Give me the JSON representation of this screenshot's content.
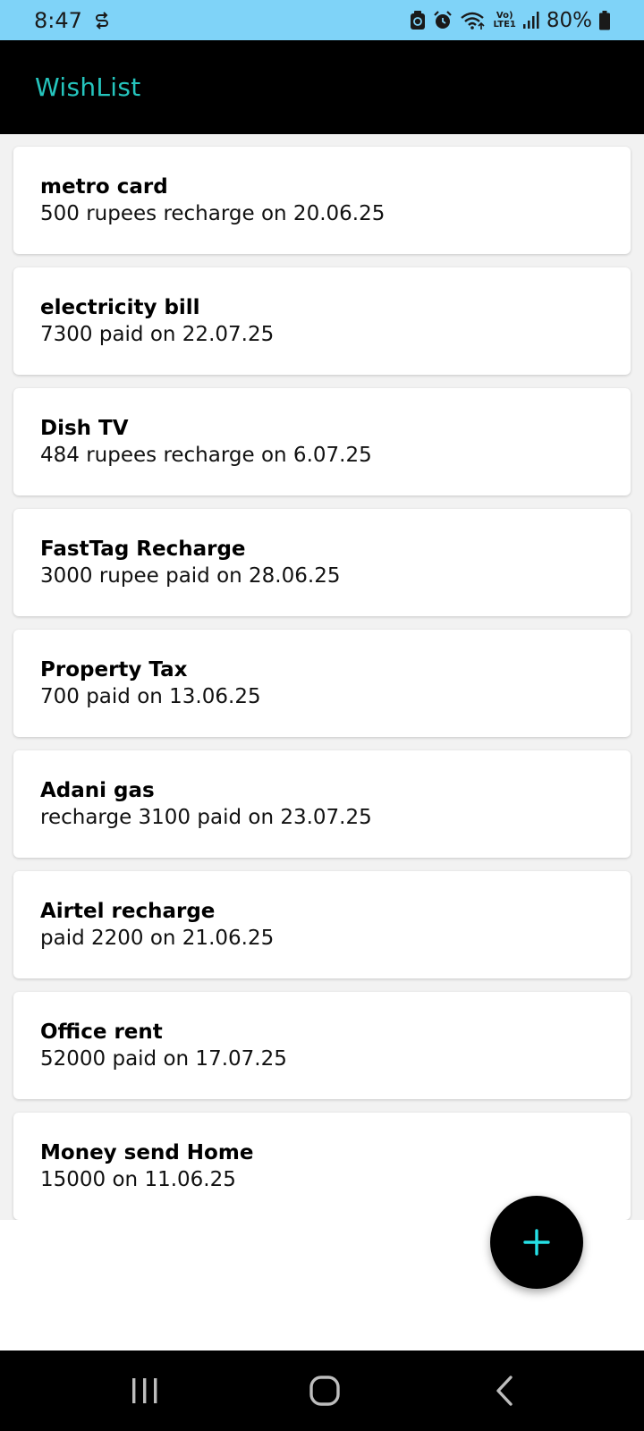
{
  "status_bar": {
    "time": "8:47",
    "battery": "80%",
    "volte_top": "Vo)",
    "volte_bottom": "LTE1",
    "icons": [
      "sync-icon",
      "save-icon",
      "alarm-icon",
      "wifi-icon",
      "volte-icon",
      "signal-icon",
      "battery-icon"
    ]
  },
  "app_bar": {
    "title": "WishList",
    "title_color": "#25c4bd"
  },
  "items": [
    {
      "title": "metro card",
      "desc": "500 rupees recharge on 20.06.25"
    },
    {
      "title": "electricity bill",
      "desc": "7300 paid on 22.07.25"
    },
    {
      "title": "Dish TV",
      "desc": "484 rupees recharge on 6.07.25"
    },
    {
      "title": "FastTag Recharge",
      "desc": "3000 rupee paid on 28.06.25"
    },
    {
      "title": "Property Tax",
      "desc": "700 paid on 13.06.25"
    },
    {
      "title": "Adani gas",
      "desc": "recharge 3100 paid on 23.07.25"
    },
    {
      "title": "Airtel recharge",
      "desc": "paid 2200 on 21.06.25"
    },
    {
      "title": "Office rent",
      "desc": "52000 paid on 17.07.25"
    },
    {
      "title": "Money send Home",
      "desc": "15000 on 11.06.25"
    }
  ],
  "fab": {
    "icon": "plus-icon",
    "icon_color": "#25e0e6"
  },
  "nav_bar": {
    "buttons": [
      "recent-apps-icon",
      "home-icon",
      "back-icon"
    ]
  },
  "colors": {
    "status_bar": "#7fd3f8",
    "app_bar": "#000000",
    "list_background": "#f2f2f2"
  }
}
